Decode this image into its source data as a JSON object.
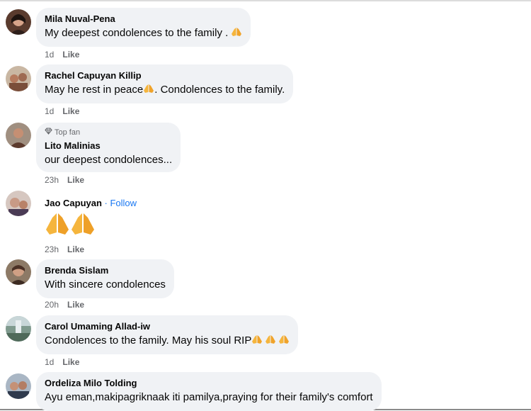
{
  "comments": [
    {
      "name": "Mila Nuval-Pena",
      "text": "My deepest condolences to the family . ",
      "time": "1d",
      "like": "Like"
    },
    {
      "name": "Rachel Capuyan Killip",
      "text_before": "May he rest in peace",
      "text_after": ". Condolences to the family.",
      "time": "1d",
      "like": "Like"
    },
    {
      "badge": "Top fan",
      "name": "Lito Malinias",
      "text": "our deepest condolences...",
      "time": "23h",
      "like": "Like"
    },
    {
      "name": "Jao Capuyan",
      "follow": " · Follow",
      "time": "23h",
      "like": "Like"
    },
    {
      "name": "Brenda Sislam",
      "text": "With sincere condolences",
      "time": "20h",
      "like": "Like"
    },
    {
      "name": "Carol Umaming Allad-iw",
      "text": "Condolences to the family. May his soul RIP",
      "time": "1d",
      "like": "Like"
    },
    {
      "name": "Ordeliza Milo Tolding",
      "text": "Ayu eman,makipagriknaak iti pamilya,praying for their family's comfort"
    }
  ],
  "icons": {
    "reaction": "folded-hands-emoji",
    "badge": "diamond-icon"
  },
  "colors": {
    "bubble": "#f0f2f5",
    "link": "#1877f2",
    "muted": "#65676b"
  }
}
